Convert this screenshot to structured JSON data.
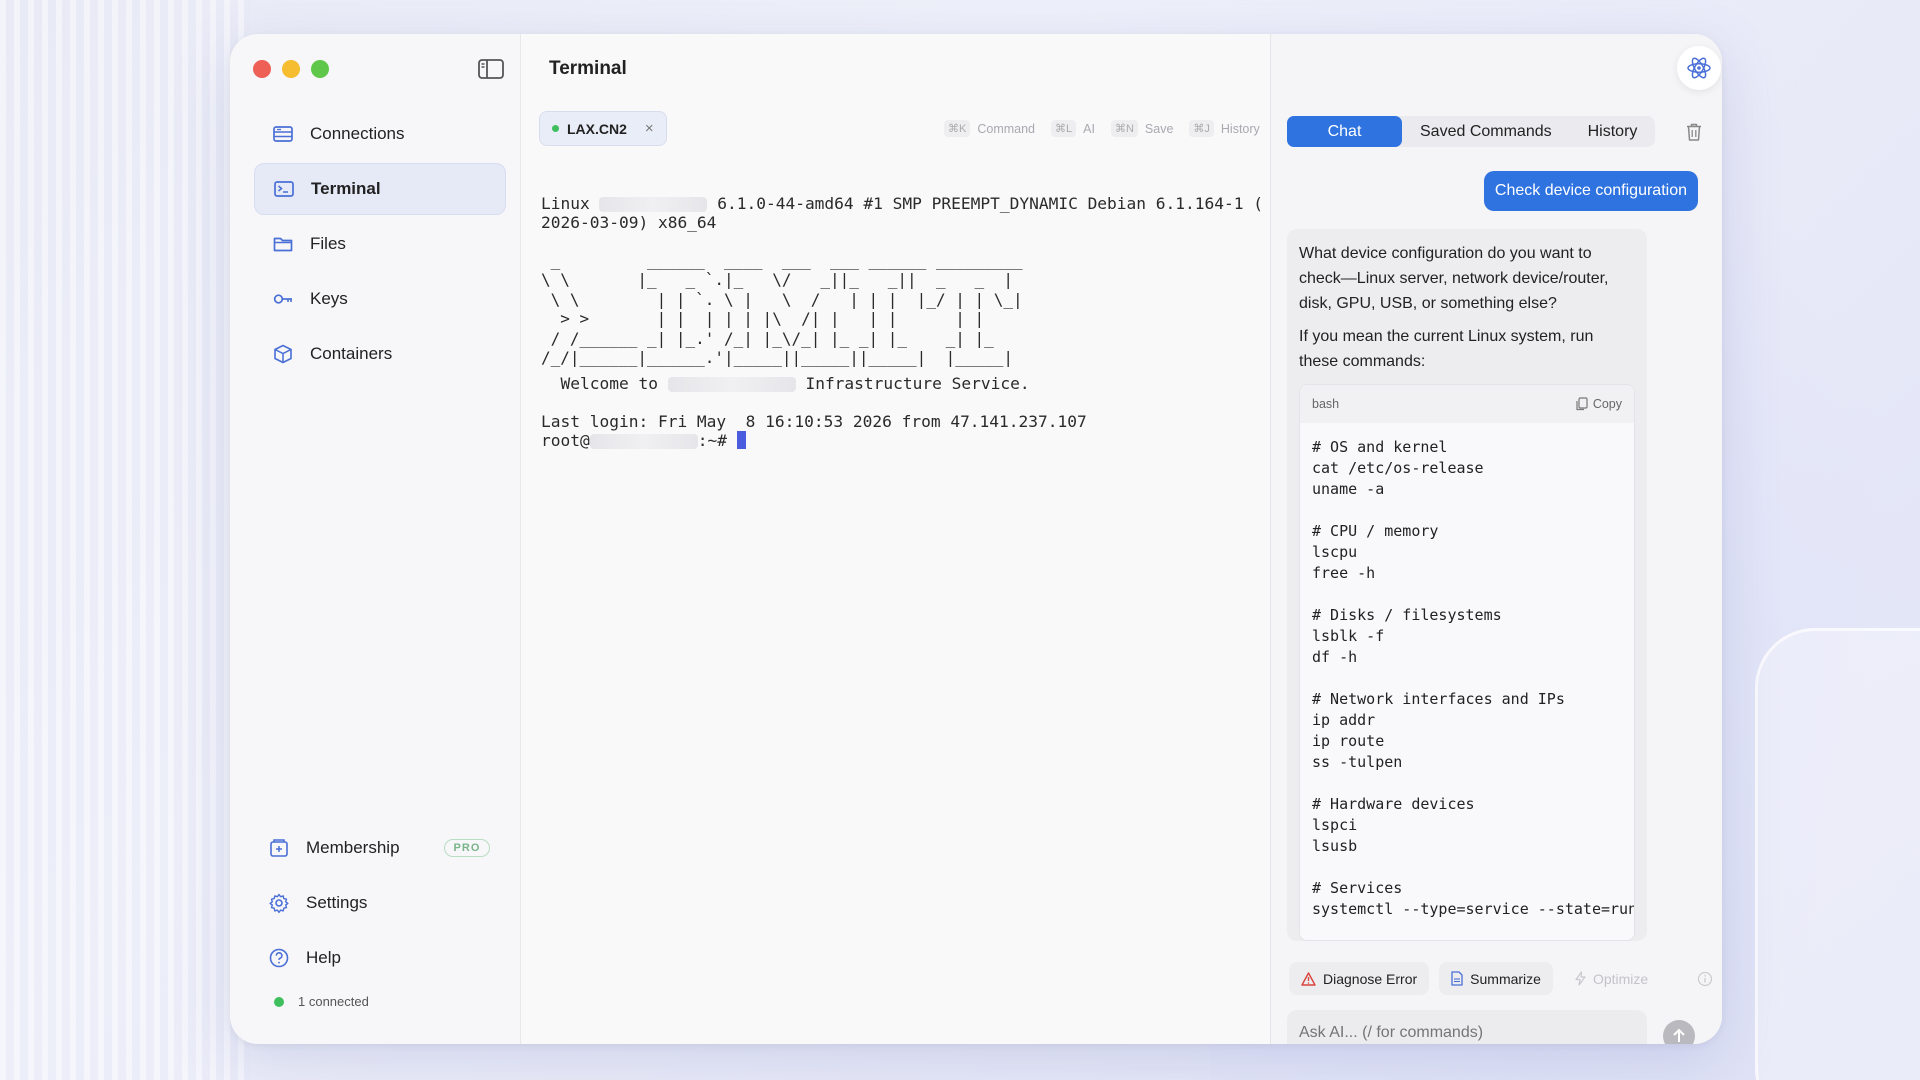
{
  "sidebar": {
    "items": [
      {
        "label": "Connections",
        "icon": "server-icon"
      },
      {
        "label": "Terminal",
        "icon": "terminal-icon",
        "active": true
      },
      {
        "label": "Files",
        "icon": "folder-icon"
      },
      {
        "label": "Keys",
        "icon": "key-icon"
      },
      {
        "label": "Containers",
        "icon": "box-icon"
      }
    ],
    "membership": "Membership",
    "pro_badge": "PRO",
    "settings": "Settings",
    "help": "Help",
    "status": "1 connected"
  },
  "terminal": {
    "title": "Terminal",
    "tab_label": "LAX.CN2",
    "shortcuts": [
      {
        "key": "⌘K",
        "label": "Command"
      },
      {
        "key": "⌘L",
        "label": "AI"
      },
      {
        "key": "⌘N",
        "label": "Save"
      },
      {
        "key": "⌘J",
        "label": "History"
      }
    ],
    "line1_a": "Linux ",
    "line1_b": " 6.1.0-44-amd64 #1 SMP PREEMPT_DYNAMIC Debian 6.1.164-1 (",
    "line2": "2026-03-09) x86_64",
    "ascii_art": " _         ______  ____  ___  ___ ______ _________\n\\ \\       |_   _ `.|_   \\/   _||_   _||  _   _  |\n \\ \\        | | `. \\ |   \\  /   | | |  |_/ | | \\_|\n  > >       | |  | | | |\\  /| |   | |      | |\n / /______ _| |_.' /_| |_\\/_| |_ _| |_    _| |_\n/_/|______|______.'|_____||_____||_____|  |_____|",
    "welcome_a": "  Welcome to ",
    "welcome_b": " Infrastructure Service.",
    "last_login": "Last login: Fri May  8 16:10:53 2026 from 47.141.237.107",
    "prompt_a": "root@",
    "prompt_b": ":~# "
  },
  "ai": {
    "tabs": [
      "Chat",
      "Saved Commands",
      "History"
    ],
    "user_message": "Check device configuration",
    "reply_p1": "What device configuration do you want to check—Linux server, network device/router, disk, GPU, USB, or something else?",
    "reply_p2": "If you mean the current Linux system, run these commands:",
    "code_lang": "bash",
    "copy_label": "Copy",
    "code": "# OS and kernel\ncat /etc/os-release\nuname -a\n\n# CPU / memory\nlscpu\nfree -h\n\n# Disks / filesystems\nlsblk -f\ndf -h\n\n# Network interfaces and IPs\nip addr\nip route\nss -tulpen\n\n# Hardware devices\nlspci\nlsusb\n\n# Services\nsystemctl --type=service --state=running",
    "actions": [
      "Diagnose Error",
      "Summarize",
      "Optimize"
    ],
    "input_placeholder": "Ask AI... (/ for commands)"
  },
  "colors": {
    "accent": "#2f73e0",
    "cursor": "#4a5dde",
    "online": "#3fbf5e"
  }
}
